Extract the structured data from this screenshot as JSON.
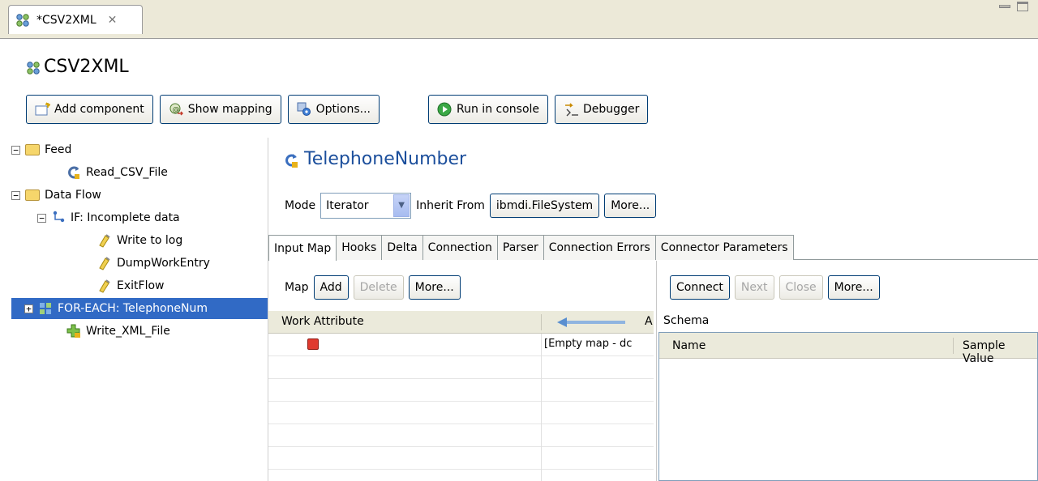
{
  "editor_tab": {
    "label": "*CSV2XML",
    "close": "✕"
  },
  "header": {
    "title": "CSV2XML"
  },
  "toolbar": {
    "add_component": "Add component",
    "show_mapping": "Show mapping",
    "options": "Options...",
    "run_in_console": "Run in console",
    "debugger": "Debugger"
  },
  "tree": {
    "feed": "Feed",
    "read_csv": "Read_CSV_File",
    "data_flow": "Data Flow",
    "if_node": "IF: Incomplete data",
    "write_to_log": "Write to log",
    "dump_work_entry": "DumpWorkEntry",
    "exit_flow": "ExitFlow",
    "for_each": "FOR-EACH: TelephoneNum",
    "write_xml": "Write_XML_File"
  },
  "component": {
    "title": "TelephoneNumber",
    "mode_label": "Mode",
    "mode_value": "Iterator",
    "inherit_label": "Inherit From",
    "inherit_value": "ibmdi.FileSystem",
    "more": "More..."
  },
  "tabs": [
    "Input Map",
    "Hooks",
    "Delta",
    "Connection",
    "Parser",
    "Connection Errors",
    "Connector Parameters"
  ],
  "map": {
    "label": "Map",
    "add": "Add",
    "delete": "Delete",
    "more": "More...",
    "col_work_attribute": "Work Attribute",
    "col_a": "A",
    "empty_text": "[Empty map - dc"
  },
  "schema": {
    "connect": "Connect",
    "next": "Next",
    "close": "Close",
    "more": "More...",
    "label": "Schema",
    "col_name": "Name",
    "col_sample": "Sample Value"
  }
}
